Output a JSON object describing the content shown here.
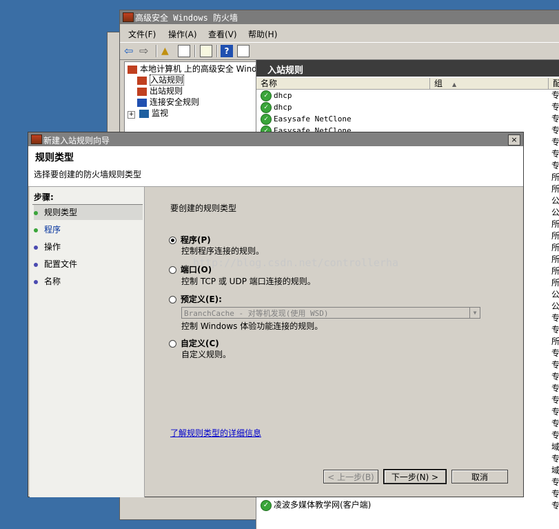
{
  "background_window": {
    "title": "高级安全 Windows 防火墙",
    "menu": [
      "文件(F)",
      "操作(A)",
      "查看(V)",
      "帮助(H)"
    ],
    "tree": {
      "root": "本地计算机 上的高级安全 Wind",
      "items": [
        "入站规则",
        "出站规则",
        "连接安全规则",
        "监视"
      ]
    },
    "pane_title": "入站规则",
    "columns": {
      "name": "名称",
      "group": "组",
      "profile": "配"
    },
    "rules": [
      "dhcp",
      "dhcp",
      "Easysafe NetClone",
      "Easysafe NetClone"
    ],
    "bottom_rule": "凌波多媒体教学网(客户端)",
    "right_column": [
      "专",
      "专",
      "专",
      "专",
      "专",
      "专",
      "专",
      "所",
      "所",
      "公",
      "公",
      "所",
      "所",
      "所",
      "所",
      "所",
      "所",
      "公",
      "公",
      "专",
      "专",
      "所",
      "专",
      "专",
      "专",
      "专",
      "专",
      "专",
      "专",
      "专",
      "域",
      "专",
      "域",
      "专",
      "专",
      "专"
    ]
  },
  "wizard": {
    "title": "新建入站规则向导",
    "close_glyph": "×",
    "heading": "规则类型",
    "subheading": "选择要创建的防火墙规则类型",
    "steps_title": "步骤:",
    "steps": [
      "规则类型",
      "程序",
      "操作",
      "配置文件",
      "名称"
    ],
    "prompt": "要创建的规则类型",
    "options": [
      {
        "label": "程序(P)",
        "desc": "控制程序连接的规则。",
        "selected": true
      },
      {
        "label": "端口(O)",
        "desc": "控制 TCP 或 UDP 端口连接的规则。",
        "selected": false
      },
      {
        "label": "预定义(E):",
        "desc": "控制 Windows 体验功能连接的规则。",
        "selected": false
      },
      {
        "label": "自定义(C)",
        "desc": "自定义规则。",
        "selected": false
      }
    ],
    "predefined_select_value": "BranchCache - 对等机发现(使用 WSD)",
    "learn_more_link": "了解规则类型的详细信息",
    "buttons": {
      "back": "< 上一步(B)",
      "next": "下一步(N) >",
      "cancel": "取消"
    },
    "watermark": "http://blog.csdn.net/controllerha"
  },
  "colors": {
    "desktop": "#3a6ea5",
    "step_current": "#3aa53a",
    "step_pending": "#4a4ab0",
    "link": "#0000cc"
  }
}
